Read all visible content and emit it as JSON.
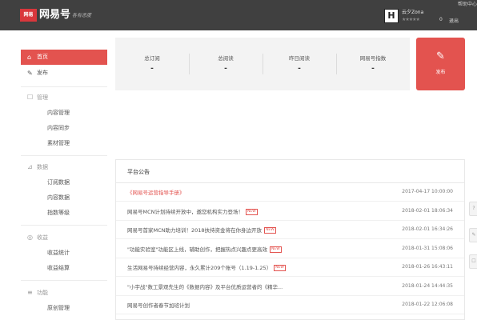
{
  "header": {
    "logo_box": "网易",
    "logo_text": "网易号",
    "slogan": "各有态度",
    "user_avatar": "H",
    "user_name": "云夕Zona",
    "stars": "★★★★★",
    "count": "0",
    "logout": "退出",
    "help": "帮助中心"
  },
  "sidebar": {
    "home": {
      "icon": "⌂",
      "label": "首页"
    },
    "publish": {
      "icon": "✎",
      "label": "发布"
    },
    "groups": [
      {
        "icon": "☐",
        "label": "管理",
        "items": [
          "内容管理",
          "内容同步",
          "素材管理"
        ]
      },
      {
        "icon": "⊿",
        "label": "数据",
        "items": [
          "订阅数据",
          "内容数据",
          "指数等级"
        ]
      },
      {
        "icon": "◎",
        "label": "收益",
        "items": [
          "收益统计",
          "收益结算"
        ]
      },
      {
        "icon": "≡",
        "label": "功能",
        "items": [
          "原创管理"
        ]
      }
    ]
  },
  "stats": [
    {
      "label": "总订阅",
      "value": "-"
    },
    {
      "label": "总阅读",
      "value": "-"
    },
    {
      "label": "昨日阅读",
      "value": "-"
    },
    {
      "label": "网易号指数",
      "value": "-"
    }
  ],
  "publish_button": {
    "icon": "✎",
    "label": "发布"
  },
  "notice": {
    "title": "平台公告",
    "new_label": "NEW",
    "rows": [
      {
        "text": "《网易号运营指导手册》",
        "date": "2017-04-17 10:00:00",
        "highlight": true,
        "is_new": false
      },
      {
        "text": "网易号MCN计划持续开放中，邀您机构实力登场！",
        "date": "2018-02-01 18:06:34",
        "highlight": false,
        "is_new": true
      },
      {
        "text": "网易号首家MCN助力培训！2018扶持资金将在你身边开放",
        "date": "2018-02-01 16:34:26",
        "highlight": false,
        "is_new": true
      },
      {
        "text": "\"功能实验室\"功能区上线，辅助创作，把握热点兴趣点更高效",
        "date": "2018-01-31 15:08:06",
        "highlight": false,
        "is_new": true
      },
      {
        "text": "生活网易号持续经营内容，永久累计209个账号（1.19-1.25）",
        "date": "2018-01-26 16:43:11",
        "highlight": false,
        "is_new": true
      },
      {
        "text": "\"小宇战\"数工景观先生的《数据内容》及平台优质运营者的《精华...",
        "date": "2018-01-24 14:44:35",
        "highlight": false,
        "is_new": false
      },
      {
        "text": "网易号创作者春节加班计划",
        "date": "2018-01-22 12:06:08",
        "highlight": false,
        "is_new": false
      }
    ]
  },
  "float_buttons": [
    "?",
    "✎",
    "☐"
  ]
}
